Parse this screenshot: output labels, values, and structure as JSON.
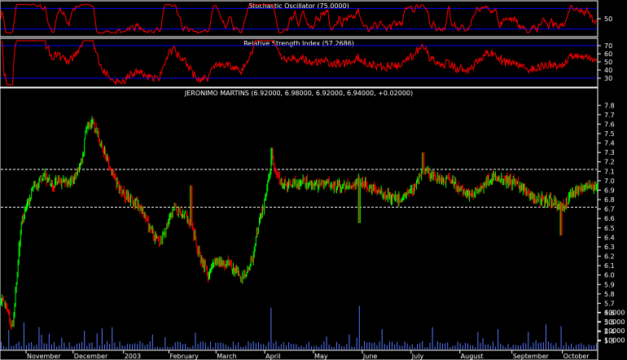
{
  "chart_data": {
    "type": "candlestick",
    "panels": {
      "stochastic": {
        "title": "Stochastic Oscillator (75.0000)",
        "ylim": [
          0,
          100
        ],
        "ticks": [
          "50"
        ],
        "tick_values": [
          50
        ],
        "bands": [
          20,
          80
        ],
        "line_color": "#ff0000",
        "band_color": "#0000ff"
      },
      "rsi": {
        "title": "Relative Strength Index (57.2686)",
        "ylim": [
          20,
          78
        ],
        "ticks": [
          "70",
          "60",
          "50",
          "40",
          "30"
        ],
        "tick_values": [
          70,
          60,
          50,
          40,
          30
        ],
        "bands": [
          30,
          70
        ],
        "line_color": "#ff0000",
        "band_color": "#0000ff"
      },
      "price": {
        "title": "JERONIMO MARTINS (6.92000, 6.98000, 6.92000, 6.94000, +0.02000)",
        "ylim": [
          5.22,
          7.88
        ],
        "ticks": [
          "7.8",
          "7.7",
          "7.6",
          "7.5",
          "7.4",
          "7.3",
          "7.2",
          "7.1",
          "7.0",
          "6.9",
          "6.8",
          "6.7",
          "6.6",
          "6.5",
          "6.4",
          "6.3",
          "6.2",
          "6.1",
          "6.0",
          "5.9",
          "5.8",
          "5.7",
          "5.6",
          "5.5",
          "5.4",
          "5.3"
        ],
        "tick_values": [
          7.8,
          7.7,
          7.6,
          7.5,
          7.4,
          7.3,
          7.2,
          7.1,
          7.0,
          6.9,
          6.8,
          6.7,
          6.6,
          6.5,
          6.4,
          6.3,
          6.2,
          6.1,
          6.0,
          5.9,
          5.8,
          5.7,
          5.6,
          5.5,
          5.4,
          5.3
        ],
        "reference_lines": [
          7.12,
          6.72
        ],
        "up_color": "#00ff00",
        "down_color": "#ff0000",
        "path": [
          [
            0,
            5.75
          ],
          [
            8,
            5.6
          ],
          [
            14,
            5.45
          ],
          [
            18,
            5.95
          ],
          [
            24,
            6.55
          ],
          [
            32,
            6.8
          ],
          [
            40,
            6.95
          ],
          [
            52,
            7.05
          ],
          [
            62,
            6.95
          ],
          [
            72,
            7.0
          ],
          [
            82,
            6.98
          ],
          [
            88,
            7.05
          ],
          [
            96,
            7.2
          ],
          [
            102,
            7.6
          ],
          [
            108,
            7.62
          ],
          [
            114,
            7.5
          ],
          [
            120,
            7.35
          ],
          [
            128,
            7.2
          ],
          [
            136,
            7.0
          ],
          [
            142,
            6.88
          ],
          [
            150,
            6.82
          ],
          [
            158,
            6.78
          ],
          [
            166,
            6.72
          ],
          [
            174,
            6.55
          ],
          [
            182,
            6.4
          ],
          [
            190,
            6.35
          ],
          [
            198,
            6.55
          ],
          [
            206,
            6.7
          ],
          [
            214,
            6.65
          ],
          [
            222,
            6.6
          ],
          [
            230,
            6.4
          ],
          [
            238,
            6.15
          ],
          [
            246,
            6.0
          ],
          [
            254,
            6.15
          ],
          [
            262,
            6.12
          ],
          [
            270,
            6.1
          ],
          [
            278,
            6.05
          ],
          [
            286,
            5.97
          ],
          [
            294,
            6.05
          ],
          [
            300,
            6.2
          ],
          [
            306,
            6.55
          ],
          [
            312,
            6.7
          ],
          [
            318,
            7.0
          ],
          [
            322,
            7.25
          ],
          [
            328,
            7.05
          ],
          [
            336,
            6.95
          ],
          [
            346,
            6.97
          ],
          [
            356,
            7.0
          ],
          [
            366,
            6.98
          ],
          [
            376,
            6.95
          ],
          [
            386,
            6.97
          ],
          [
            396,
            6.95
          ],
          [
            406,
            6.93
          ],
          [
            416,
            6.97
          ],
          [
            426,
            7.0
          ],
          [
            436,
            6.95
          ],
          [
            446,
            6.9
          ],
          [
            456,
            6.85
          ],
          [
            466,
            6.82
          ],
          [
            476,
            6.8
          ],
          [
            486,
            6.88
          ],
          [
            496,
            7.0
          ],
          [
            502,
            7.15
          ],
          [
            508,
            7.08
          ],
          [
            516,
            7.05
          ],
          [
            526,
            7.02
          ],
          [
            536,
            6.98
          ],
          [
            546,
            6.92
          ],
          [
            556,
            6.85
          ],
          [
            566,
            6.88
          ],
          [
            576,
            6.98
          ],
          [
            586,
            7.05
          ],
          [
            596,
            7.0
          ],
          [
            606,
            6.98
          ],
          [
            616,
            6.95
          ],
          [
            626,
            6.88
          ],
          [
            636,
            6.82
          ],
          [
            646,
            6.8
          ],
          [
            656,
            6.78
          ],
          [
            664,
            6.72
          ],
          [
            670,
            6.72
          ],
          [
            676,
            6.82
          ],
          [
            684,
            6.9
          ],
          [
            694,
            6.93
          ],
          [
            704,
            6.94
          ]
        ],
        "spikes": [
          [
            22,
            2,
            6.35
          ],
          [
            108,
            2,
            7.65
          ],
          [
            226,
            2,
            6.95
          ],
          [
            322,
            2,
            7.35
          ],
          [
            426,
            2,
            6.55
          ],
          [
            502,
            2,
            7.3
          ],
          [
            666,
            2,
            6.42
          ]
        ]
      },
      "volume": {
        "ylim": [
          0,
          50000
        ],
        "ticks": [
          "40000",
          "30000",
          "20000",
          "10000"
        ],
        "tick_values": [
          40000,
          30000,
          20000,
          10000
        ],
        "bar_color": "#5577ff",
        "peaks": [
          [
            8,
            21000
          ],
          [
            26,
            29000
          ],
          [
            44,
            24000
          ],
          [
            98,
            20000
          ],
          [
            120,
            23000
          ],
          [
            132,
            24000
          ],
          [
            180,
            16000
          ],
          [
            232,
            18000
          ],
          [
            320,
            45000
          ],
          [
            426,
            47000
          ],
          [
            454,
            22000
          ],
          [
            512,
            24000
          ],
          [
            592,
            22000
          ],
          [
            626,
            19000
          ],
          [
            648,
            27000
          ],
          [
            666,
            25000
          ]
        ]
      }
    },
    "x_labels": [
      "November",
      "December",
      "2003",
      "February",
      "March",
      "April",
      "May",
      "June",
      "July",
      "August",
      "September",
      "October"
    ],
    "x_label_bars": [
      30,
      86,
      146,
      200,
      256,
      314,
      372,
      430,
      488,
      546,
      608,
      668
    ],
    "n_bars": 710,
    "grid": false,
    "legend": "none"
  }
}
